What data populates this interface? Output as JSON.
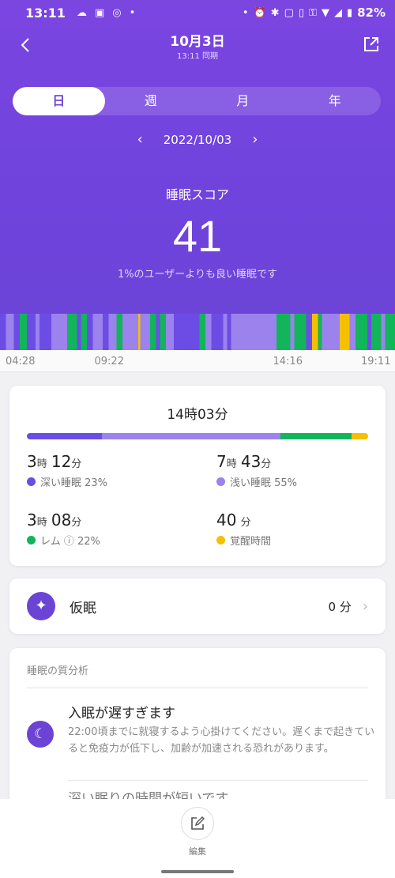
{
  "status_bar": {
    "time": "13:11",
    "battery": "82%"
  },
  "header": {
    "title": "10月3日",
    "subtitle": "13:11 同期",
    "tabs": [
      {
        "label": "日",
        "active": true
      },
      {
        "label": "週",
        "active": false
      },
      {
        "label": "月",
        "active": false
      },
      {
        "label": "年",
        "active": false
      }
    ],
    "date": "2022/10/03",
    "prev_arrow": "‹",
    "next_arrow": "›"
  },
  "score": {
    "label": "睡眠スコア",
    "value": "41",
    "description": "1%のユーザーよりも良い睡眠です"
  },
  "timeline": {
    "colors": {
      "deep": "#6b4de6",
      "light": "#9b82ec",
      "rem": "#12b559",
      "awake": "#f5c000"
    },
    "segments": [
      {
        "stage": "deep",
        "start": 0.0,
        "end": 0.015
      },
      {
        "stage": "light",
        "start": 0.015,
        "end": 0.035
      },
      {
        "stage": "deep",
        "start": 0.035,
        "end": 0.05
      },
      {
        "stage": "rem",
        "start": 0.05,
        "end": 0.068
      },
      {
        "stage": "deep",
        "start": 0.068,
        "end": 0.09
      },
      {
        "stage": "light",
        "start": 0.09,
        "end": 0.1
      },
      {
        "stage": "deep",
        "start": 0.1,
        "end": 0.13
      },
      {
        "stage": "light",
        "start": 0.13,
        "end": 0.17
      },
      {
        "stage": "rem",
        "start": 0.17,
        "end": 0.195
      },
      {
        "stage": "deep",
        "start": 0.195,
        "end": 0.205
      },
      {
        "stage": "rem",
        "start": 0.205,
        "end": 0.22
      },
      {
        "stage": "deep",
        "start": 0.22,
        "end": 0.235
      },
      {
        "stage": "light",
        "start": 0.235,
        "end": 0.26
      },
      {
        "stage": "deep",
        "start": 0.26,
        "end": 0.275
      },
      {
        "stage": "light",
        "start": 0.275,
        "end": 0.295
      },
      {
        "stage": "rem",
        "start": 0.295,
        "end": 0.31
      },
      {
        "stage": "light",
        "start": 0.31,
        "end": 0.35
      },
      {
        "stage": "awake",
        "start": 0.35,
        "end": 0.355
      },
      {
        "stage": "light",
        "start": 0.355,
        "end": 0.38
      },
      {
        "stage": "rem",
        "start": 0.38,
        "end": 0.395
      },
      {
        "stage": "deep",
        "start": 0.395,
        "end": 0.405
      },
      {
        "stage": "rem",
        "start": 0.405,
        "end": 0.42
      },
      {
        "stage": "light",
        "start": 0.42,
        "end": 0.44
      },
      {
        "stage": "deep",
        "start": 0.44,
        "end": 0.505
      },
      {
        "stage": "rem",
        "start": 0.505,
        "end": 0.52
      },
      {
        "stage": "light",
        "start": 0.52,
        "end": 0.535
      },
      {
        "stage": "deep",
        "start": 0.535,
        "end": 0.565
      },
      {
        "stage": "light",
        "start": 0.565,
        "end": 0.575
      },
      {
        "stage": "deep",
        "start": 0.575,
        "end": 0.585
      },
      {
        "stage": "light",
        "start": 0.585,
        "end": 0.7
      },
      {
        "stage": "rem",
        "start": 0.7,
        "end": 0.735
      },
      {
        "stage": "light",
        "start": 0.735,
        "end": 0.745
      },
      {
        "stage": "rem",
        "start": 0.745,
        "end": 0.775
      },
      {
        "stage": "deep",
        "start": 0.775,
        "end": 0.79
      },
      {
        "stage": "awake",
        "start": 0.79,
        "end": 0.805
      },
      {
        "stage": "rem",
        "start": 0.805,
        "end": 0.815
      },
      {
        "stage": "light",
        "start": 0.815,
        "end": 0.86
      },
      {
        "stage": "awake",
        "start": 0.86,
        "end": 0.885
      },
      {
        "stage": "light",
        "start": 0.885,
        "end": 0.9
      },
      {
        "stage": "rem",
        "start": 0.9,
        "end": 0.93
      },
      {
        "stage": "deep",
        "start": 0.93,
        "end": 0.94
      },
      {
        "stage": "rem",
        "start": 0.94,
        "end": 0.965
      },
      {
        "stage": "light",
        "start": 0.965,
        "end": 0.975
      },
      {
        "stage": "rem",
        "start": 0.975,
        "end": 1.0
      }
    ],
    "axis_labels": [
      {
        "text": "04:28",
        "pos": 0.05
      },
      {
        "text": "09:22",
        "pos": 0.275
      },
      {
        "text": "14:16",
        "pos": 0.727
      },
      {
        "text": "19:11",
        "pos": 0.95
      }
    ]
  },
  "summary": {
    "total": "14時03分",
    "stats": [
      {
        "key": "deep",
        "h": "3",
        "hu": "時",
        "m": "12",
        "mu": "分",
        "label": "深い睡眠 23%",
        "color": "#6b4de6",
        "share": 0.23
      },
      {
        "key": "light",
        "h": "7",
        "hu": "時",
        "m": "43",
        "mu": "分",
        "label": "浅い睡眠 55%",
        "color": "#9b82ec",
        "share": 0.55
      },
      {
        "key": "rem",
        "h": "3",
        "hu": "時",
        "m": "08",
        "mu": "分",
        "label": "レム ⓘ 22%",
        "color": "#12b559",
        "share": 0.22
      },
      {
        "key": "awake",
        "h": "",
        "hu": "",
        "m": "40",
        "mu": "分",
        "label": "覚醒時間",
        "color": "#f5c000",
        "share": 0.05
      }
    ]
  },
  "nap": {
    "label": "仮眠",
    "value": "0 分",
    "icon": "sparkle-icon"
  },
  "analysis": {
    "title": "睡眠の質分析",
    "item_title": "入眠が遅すぎます",
    "item_body": "22:00頃までに就寝するよう心掛けてください。遅くまで起きていると免疫力が低下し、加齢が加速される恐れがあります。",
    "next_item_title": "深い眠りの時間が短いです"
  },
  "bottom": {
    "edit_label": "編集"
  }
}
